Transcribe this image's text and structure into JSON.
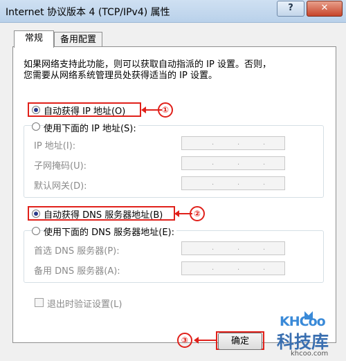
{
  "window": {
    "title": "Internet 协议版本 4 (TCP/IPv4) 属性"
  },
  "titlebar_buttons": {
    "help": "?",
    "close": "✕"
  },
  "tabs": [
    {
      "label": "常规"
    },
    {
      "label": "备用配置"
    }
  ],
  "description": {
    "line1": "如果网络支持此功能，则可以获取自动指派的 IP 设置。否则，",
    "line2": "您需要从网络系统管理员处获得适当的 IP 设置。"
  },
  "ip_section": {
    "auto_label": "自动获得 IP 地址(O)",
    "manual_label": "使用下面的 IP 地址(S):",
    "fields": [
      {
        "label": "IP 地址(I):"
      },
      {
        "label": "子网掩码(U):"
      },
      {
        "label": "默认网关(D):"
      }
    ]
  },
  "dns_section": {
    "auto_label": "自动获得 DNS 服务器地址(B)",
    "manual_label": "使用下面的 DNS 服务器地址(E):",
    "fields": [
      {
        "label": "首选 DNS 服务器(P):"
      },
      {
        "label": "备用 DNS 服务器(A):"
      }
    ]
  },
  "validate_label": "退出时验证设置(L)",
  "ok_button": "确定",
  "annotations": [
    "①",
    "②",
    "③"
  ],
  "watermark": {
    "brand": "KHCoo",
    "name": "科技库",
    "url": "khcoo.com"
  },
  "colors": {
    "annotation": "#e0201a",
    "selected_radio": "#2a3a8a"
  }
}
